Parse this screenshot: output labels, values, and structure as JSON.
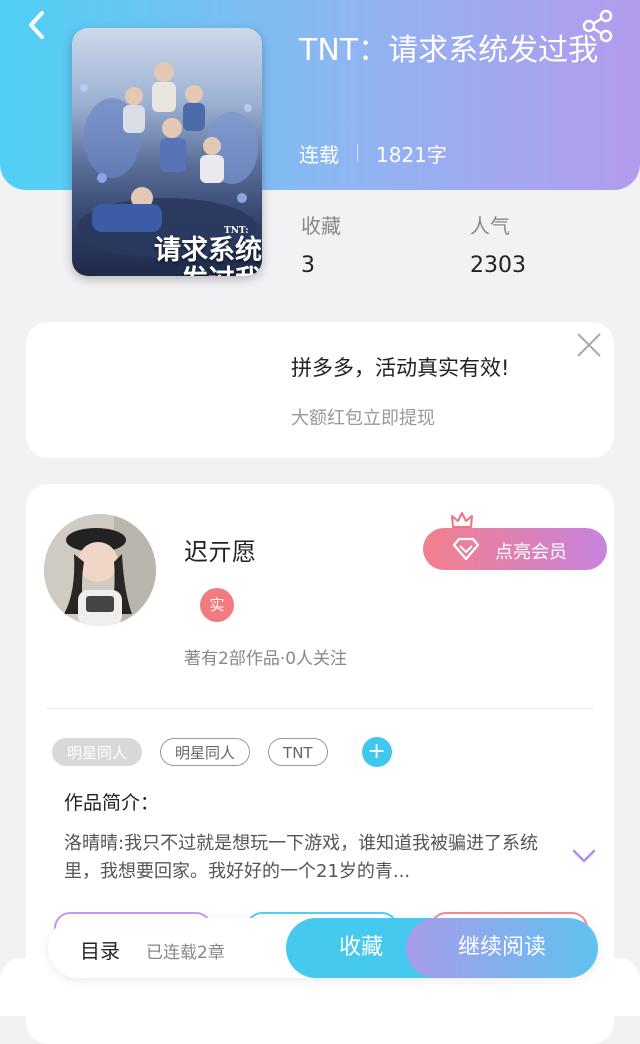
{
  "header": {
    "book_title": "TNT：请求系统发过我",
    "status": "连载",
    "word_count": "1821字",
    "cover_title": "请求系统发过我",
    "cover_tag": "TNT:"
  },
  "stats": {
    "favorites_label": "收藏",
    "favorites_value": "3",
    "popularity_label": "人气",
    "popularity_value": "2303"
  },
  "ad": {
    "title": "拼多多，活动真实有效!",
    "subtitle": "大额红包立即提现"
  },
  "author": {
    "name": "迟亓愿",
    "verified_badge": "实",
    "stats": "著有2部作品·0人关注",
    "vip_button": "点亮会员"
  },
  "tags": [
    "明星同人",
    "明星同人",
    "TNT"
  ],
  "tag_add": "+",
  "intro": {
    "label": "作品简介：",
    "text": "洛晴晴:我只不过就是想玩一下游戏，谁知道我被骗进了系统里，我想要回家。我好好的一个21岁的青..."
  },
  "toolbar": {
    "toc": "目录",
    "toc_status": "已连载2章",
    "favorite": "收藏",
    "continue_reading": "继续阅读"
  },
  "colors": {
    "header_start": "#4fd0f4",
    "header_end": "#b49bee",
    "accent_blue": "#46c9ee",
    "vip_pink": "#f37f8b"
  }
}
